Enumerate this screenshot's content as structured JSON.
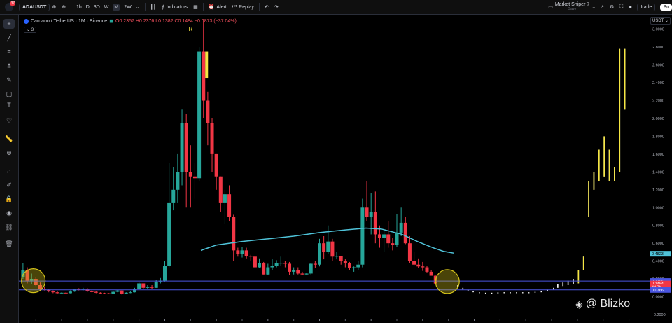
{
  "topbar": {
    "avatar_badge": "37",
    "symbol": "ADAUSDT",
    "timeframes": [
      "1h",
      "D",
      "3D",
      "W",
      "M",
      "2W"
    ],
    "indicators_label": "Indicators",
    "alert_label": "Alert",
    "replay_label": "Replay",
    "layout_name": "Market Sniper 7",
    "layout_status": "Save",
    "trade_label": "Irade",
    "publish_label": "Pu"
  },
  "legend": {
    "title": "Cardano / TetherUS · 1M · Binance",
    "ohlc": "O0.2357 H0.2376 L0.1382 C0.1484 −0.0873 (−37.04%)",
    "indicator_count": "3"
  },
  "price_axis": {
    "currency": "USDT",
    "tag_cyan": "0.4823",
    "tag_blue_upper": "0.1765",
    "tag_red": "0.1484",
    "tag_countdown": "4d 7h",
    "tag_blue_lower": "0.0766"
  },
  "watermark": {
    "text": "@ Blizko"
  },
  "marker_label": "R",
  "colors": {
    "bull": "#26a69a",
    "bear": "#f23645",
    "yellow": "#f5e642",
    "ma": "#4fc3d9",
    "hline": "#4a55e0",
    "circle": "#d4c31a",
    "background": "#000000"
  },
  "chart_data": {
    "type": "candlestick",
    "timeframe": "1M",
    "ylim": [
      -0.2,
      3.1
    ],
    "y_ticks": [
      3.0,
      2.8,
      2.6,
      2.4,
      2.2,
      2.0,
      1.8,
      1.6,
      1.4,
      1.2,
      1.0,
      0.8,
      0.6,
      0.4,
      0.2,
      0.0,
      -0.2
    ],
    "y_tick_labels": [
      "3.0000",
      "2.8000",
      "2.6000",
      "2.4000",
      "2.2000",
      "2.0000",
      "1.8000",
      "1.6000",
      "1.4000",
      "1.2000",
      "1.0000",
      "0.8000",
      "0.6000",
      "0.4000",
      "0.2000",
      "0.0000",
      "-0.2000"
    ],
    "x_range": [
      2018.17,
      2030.4
    ],
    "x_ticks": [
      2019,
      2020,
      2021,
      2022,
      2023,
      2024,
      2025,
      2026,
      2027,
      2028,
      2029,
      2030
    ],
    "x_mid_ticks": [
      2018.5,
      2019.5,
      2020.5,
      2021.5,
      2022.5,
      2023.5,
      2024.5,
      2025.5,
      2026.5,
      2027.5,
      2028.5,
      2029.5
    ],
    "series": [
      {
        "name": "ADAUSDT",
        "kind": "ohlc",
        "start": 2018.25,
        "step_months": 1,
        "candles": [
          [
            0.22,
            0.38,
            0.2,
            0.3
          ],
          [
            0.3,
            0.33,
            0.15,
            0.18
          ],
          [
            0.18,
            0.26,
            0.14,
            0.2
          ],
          [
            0.2,
            0.22,
            0.12,
            0.13
          ],
          [
            0.13,
            0.16,
            0.07,
            0.09
          ],
          [
            0.09,
            0.11,
            0.07,
            0.08
          ],
          [
            0.08,
            0.09,
            0.05,
            0.06
          ],
          [
            0.06,
            0.07,
            0.04,
            0.05
          ],
          [
            0.05,
            0.06,
            0.03,
            0.04
          ],
          [
            0.04,
            0.05,
            0.03,
            0.045
          ],
          [
            0.045,
            0.05,
            0.038,
            0.04
          ],
          [
            0.04,
            0.07,
            0.038,
            0.058
          ],
          [
            0.058,
            0.09,
            0.055,
            0.085
          ],
          [
            0.085,
            0.095,
            0.07,
            0.08
          ],
          [
            0.08,
            0.1,
            0.07,
            0.09
          ],
          [
            0.09,
            0.095,
            0.055,
            0.06
          ],
          [
            0.06,
            0.07,
            0.05,
            0.055
          ],
          [
            0.055,
            0.06,
            0.04,
            0.045
          ],
          [
            0.045,
            0.05,
            0.035,
            0.04
          ],
          [
            0.04,
            0.045,
            0.035,
            0.038
          ],
          [
            0.038,
            0.042,
            0.033,
            0.035
          ],
          [
            0.035,
            0.06,
            0.034,
            0.055
          ],
          [
            0.055,
            0.075,
            0.05,
            0.07
          ],
          [
            0.07,
            0.07,
            0.025,
            0.035
          ],
          [
            0.035,
            0.05,
            0.032,
            0.045
          ],
          [
            0.045,
            0.06,
            0.04,
            0.05
          ],
          [
            0.05,
            0.1,
            0.048,
            0.09
          ],
          [
            0.09,
            0.16,
            0.085,
            0.15
          ],
          [
            0.15,
            0.15,
            0.09,
            0.1
          ],
          [
            0.1,
            0.13,
            0.09,
            0.11
          ],
          [
            0.11,
            0.13,
            0.09,
            0.1
          ],
          [
            0.1,
            0.19,
            0.1,
            0.17
          ],
          [
            0.17,
            0.21,
            0.15,
            0.18
          ],
          [
            0.18,
            0.4,
            0.17,
            0.35
          ],
          [
            0.35,
            1.5,
            0.33,
            1.05
          ],
          [
            1.05,
            1.45,
            0.97,
            1.2
          ],
          [
            1.2,
            1.6,
            1.05,
            1.4
          ],
          [
            1.4,
            2.1,
            1.25,
            1.95
          ],
          [
            1.95,
            2.05,
            1.0,
            1.4
          ],
          [
            1.4,
            1.7,
            1.0,
            1.35
          ],
          [
            1.35,
            1.5,
            1.1,
            1.33
          ],
          [
            1.33,
            2.8,
            1.3,
            2.75
          ],
          [
            2.75,
            3.1,
            2.0,
            2.2
          ],
          [
            2.2,
            2.3,
            1.7,
            1.95
          ],
          [
            1.95,
            2.0,
            1.4,
            1.6
          ],
          [
            1.6,
            1.6,
            1.2,
            1.35
          ],
          [
            1.35,
            1.35,
            0.95,
            1.05
          ],
          [
            1.05,
            1.2,
            0.82,
            1.15
          ],
          [
            1.15,
            1.25,
            0.85,
            0.9
          ],
          [
            0.9,
            0.92,
            0.4,
            0.52
          ],
          [
            0.52,
            0.55,
            0.45,
            0.48
          ],
          [
            0.48,
            0.56,
            0.44,
            0.52
          ],
          [
            0.52,
            0.55,
            0.43,
            0.46
          ],
          [
            0.46,
            0.47,
            0.4,
            0.45
          ],
          [
            0.45,
            0.46,
            0.32,
            0.33
          ],
          [
            0.33,
            0.43,
            0.32,
            0.38
          ],
          [
            0.38,
            0.39,
            0.25,
            0.25
          ],
          [
            0.25,
            0.37,
            0.24,
            0.33
          ],
          [
            0.33,
            0.42,
            0.3,
            0.35
          ],
          [
            0.35,
            0.41,
            0.33,
            0.38
          ],
          [
            0.38,
            0.45,
            0.35,
            0.38
          ],
          [
            0.38,
            0.4,
            0.33,
            0.37
          ],
          [
            0.37,
            0.39,
            0.24,
            0.28
          ],
          [
            0.28,
            0.33,
            0.25,
            0.3
          ],
          [
            0.3,
            0.33,
            0.25,
            0.26
          ],
          [
            0.26,
            0.28,
            0.24,
            0.25
          ],
          [
            0.25,
            0.27,
            0.24,
            0.26
          ],
          [
            0.26,
            0.38,
            0.25,
            0.37
          ],
          [
            0.37,
            0.4,
            0.32,
            0.36
          ],
          [
            0.36,
            0.65,
            0.34,
            0.6
          ],
          [
            0.6,
            0.68,
            0.42,
            0.5
          ],
          [
            0.5,
            0.8,
            0.48,
            0.62
          ],
          [
            0.62,
            0.65,
            0.4,
            0.45
          ],
          [
            0.45,
            0.5,
            0.42,
            0.46
          ],
          [
            0.46,
            0.46,
            0.36,
            0.4
          ],
          [
            0.4,
            0.42,
            0.33,
            0.38
          ],
          [
            0.38,
            0.39,
            0.3,
            0.32
          ],
          [
            0.32,
            0.34,
            0.28,
            0.33
          ],
          [
            0.33,
            0.4,
            0.3,
            0.36
          ],
          [
            0.36,
            1.1,
            0.33,
            1.0
          ],
          [
            1.0,
            1.3,
            0.85,
            0.9
          ],
          [
            0.9,
            1.16,
            0.7,
            0.95
          ],
          [
            0.95,
            1.18,
            0.6,
            0.7
          ],
          [
            0.7,
            0.8,
            0.55,
            0.66
          ],
          [
            0.66,
            0.75,
            0.5,
            0.7
          ],
          [
            0.7,
            0.85,
            0.55,
            0.6
          ],
          [
            0.6,
            0.66,
            0.52,
            0.58
          ],
          [
            0.58,
            0.93,
            0.56,
            0.72
          ],
          [
            0.72,
            1.0,
            0.68,
            0.83
          ],
          [
            0.83,
            0.9,
            0.59,
            0.6
          ],
          [
            0.6,
            0.68,
            0.38,
            0.4
          ],
          [
            0.4,
            0.5,
            0.35,
            0.36
          ],
          [
            0.36,
            0.43,
            0.32,
            0.34
          ],
          [
            0.34,
            0.39,
            0.29,
            0.33
          ],
          [
            0.33,
            0.35,
            0.27,
            0.28
          ],
          [
            0.28,
            0.3,
            0.25,
            0.2357
          ],
          [
            0.2357,
            0.2376,
            0.1382,
            0.1484
          ]
        ]
      },
      {
        "name": "MA",
        "kind": "line",
        "points": [
          [
            2021.7,
            0.52
          ],
          [
            2022.0,
            0.58
          ],
          [
            2022.5,
            0.62
          ],
          [
            2023.0,
            0.65
          ],
          [
            2023.5,
            0.68
          ],
          [
            2024.0,
            0.72
          ],
          [
            2024.5,
            0.75
          ],
          [
            2024.9,
            0.77
          ],
          [
            2025.2,
            0.76
          ],
          [
            2025.6,
            0.7
          ],
          [
            2025.9,
            0.62
          ],
          [
            2026.2,
            0.55
          ],
          [
            2026.4,
            0.51
          ],
          [
            2026.6,
            0.49
          ]
        ]
      },
      {
        "name": "Projection",
        "kind": "bars",
        "bars": [
          [
            2026.68,
            0.1,
            0.13
          ],
          [
            2026.78,
            0.08,
            0.1
          ],
          [
            2026.88,
            0.06,
            0.08
          ],
          [
            2026.98,
            0.05,
            0.06
          ],
          [
            2027.1,
            0.04,
            0.05
          ],
          [
            2027.22,
            0.035,
            0.045
          ],
          [
            2027.34,
            0.035,
            0.045
          ],
          [
            2027.46,
            0.035,
            0.05
          ],
          [
            2027.58,
            0.04,
            0.05
          ],
          [
            2027.7,
            0.04,
            0.05
          ],
          [
            2027.82,
            0.04,
            0.05
          ],
          [
            2027.94,
            0.04,
            0.05
          ],
          [
            2028.06,
            0.04,
            0.05
          ],
          [
            2028.18,
            0.045,
            0.055
          ],
          [
            2028.3,
            0.05,
            0.06
          ],
          [
            2028.42,
            0.06,
            0.08
          ],
          [
            2028.54,
            0.08,
            0.1
          ],
          [
            2028.62,
            0.1,
            0.14
          ],
          [
            2028.72,
            0.12,
            0.16
          ],
          [
            2028.82,
            0.13,
            0.18
          ],
          [
            2028.92,
            0.14,
            0.2
          ],
          [
            2029.02,
            0.15,
            0.3
          ],
          [
            2029.12,
            0.3,
            0.45
          ],
          [
            2029.22,
            0.9,
            1.3
          ],
          [
            2029.32,
            1.2,
            1.4
          ],
          [
            2029.42,
            1.3,
            1.65
          ],
          [
            2029.52,
            1.35,
            1.8
          ],
          [
            2029.62,
            1.3,
            1.65
          ],
          [
            2029.72,
            1.3,
            1.45
          ],
          [
            2029.82,
            1.4,
            2.78
          ],
          [
            2029.92,
            2.1,
            2.78
          ]
        ]
      }
    ],
    "horizontal_lines": [
      0.1765,
      0.0766
    ],
    "circles": [
      [
        2018.45,
        0.18
      ],
      [
        2026.48,
        0.17
      ]
    ],
    "marker": {
      "x": 2021.5,
      "label": "R"
    }
  }
}
